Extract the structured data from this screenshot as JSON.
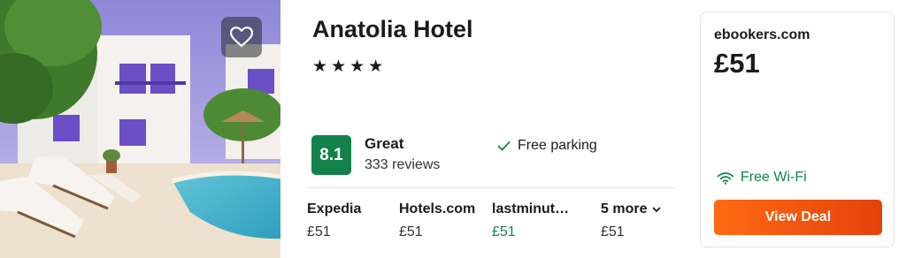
{
  "hotel": {
    "name": "Anatolia Hotel",
    "stars": "★★★★"
  },
  "rating": {
    "score": "8.1",
    "label": "Great",
    "reviews": "333 reviews"
  },
  "amenity": {
    "label": "Free parking",
    "icon": "check-icon"
  },
  "providers": [
    {
      "name": "Expedia",
      "price": "£51"
    },
    {
      "name": "Hotels.com",
      "price": "£51"
    },
    {
      "name": "lastminut…",
      "price": "£51",
      "price_color": "#13824a"
    },
    {
      "name": "5 more",
      "price": "£51"
    }
  ],
  "deal": {
    "provider": "ebookers.com",
    "price": "£51",
    "wifi": "Free Wi-Fi",
    "button": "View Deal"
  },
  "colors": {
    "rating_badge": "#13824a",
    "deal_button": "#f05a11",
    "green_text": "#13824a"
  },
  "icons": [
    "heart-icon",
    "check-icon",
    "chevron-down-icon",
    "wifi-icon"
  ]
}
